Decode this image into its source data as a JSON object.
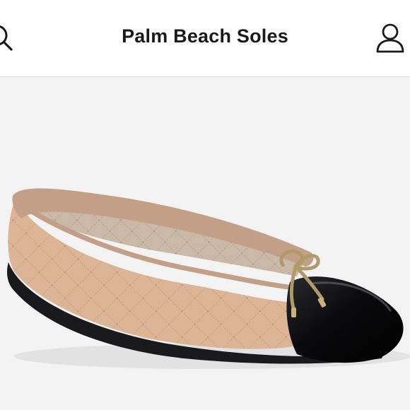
{
  "header": {
    "title": "Palm Beach Soles",
    "search_icon": "search-icon",
    "account_icon": "user-icon"
  },
  "product": {
    "image": "beige quilted ballet flat with black patent cap toe and gold rope bow",
    "colors": {
      "background": "#f3f3f3",
      "upper": "#dcb597",
      "toe_cap": "#0c0c0e",
      "bow": "#b19a6a"
    }
  }
}
